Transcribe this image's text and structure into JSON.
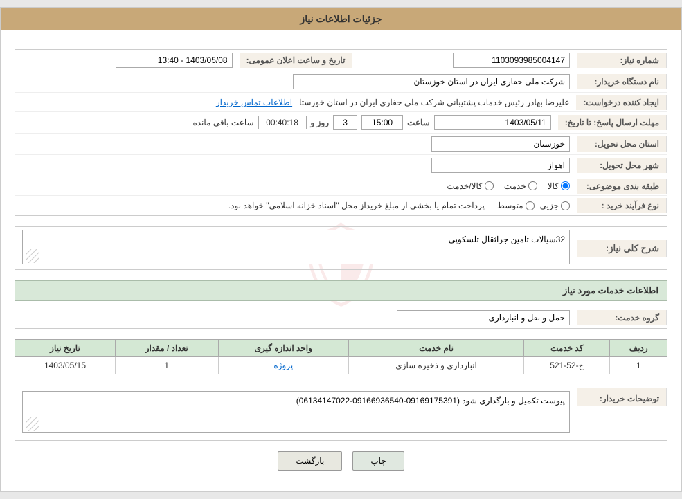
{
  "header": {
    "title": "جزئیات اطلاعات نیاز"
  },
  "fields": {
    "need_number_label": "شماره نیاز:",
    "need_number_value": "1103093985004147",
    "announce_date_label": "تاریخ و ساعت اعلان عمومی:",
    "announce_date_value": "1403/05/08 - 13:40",
    "buyer_org_label": "نام دستگاه خریدار:",
    "buyer_org_value": "شرکت ملی حفاری ایران در استان خوزستان",
    "creator_label": "ایجاد کننده درخواست:",
    "creator_value": "علیرضا بهادر رئیس خدمات پشتیبانی شرکت ملی حفاری ایران در استان خوزستا",
    "creator_link": "اطلاعات تماس خریدار",
    "deadline_label": "مهلت ارسال پاسخ: تا تاریخ:",
    "deadline_date": "1403/05/11",
    "deadline_time": "15:00",
    "deadline_days": "3",
    "deadline_countdown": "00:40:18",
    "deadline_remaining": "ساعت باقی مانده",
    "deadline_days_label": "روز و",
    "province_label": "استان محل تحویل:",
    "province_value": "خوزستان",
    "city_label": "شهر محل تحویل:",
    "city_value": "اهواز",
    "category_label": "طبقه بندی موضوعی:",
    "category_options": [
      "کالا",
      "خدمت",
      "کالا/خدمت"
    ],
    "category_selected": "کالا",
    "purchase_type_label": "نوع فرآیند خرید :",
    "purchase_options": [
      "جزیی",
      "متوسط"
    ],
    "purchase_note": "پرداخت تمام یا بخشی از مبلغ خریداز محل \"اسناد خزانه اسلامی\" خواهد بود.",
    "need_desc_label": "شرح کلی نیاز:",
    "need_desc_value": "32سیالات تامین جراثقال تلسکوپی",
    "services_info_label": "اطلاعات خدمات مورد نیاز",
    "service_group_label": "گروه خدمت:",
    "service_group_value": "حمل و نقل و انبارداری",
    "table": {
      "headers": [
        "ردیف",
        "کد خدمت",
        "نام خدمت",
        "واحد اندازه گیری",
        "تعداد / مقدار",
        "تاریخ نیاز"
      ],
      "rows": [
        {
          "row": "1",
          "code": "ح-52-521",
          "name": "انبارداری و ذخیره سازی",
          "unit": "پروژه",
          "quantity": "1",
          "date": "1403/05/15"
        }
      ]
    },
    "buyer_desc_label": "توضیحات خریدار:",
    "buyer_desc_value": "پیوست تکمیل و بارگذاری شود (09169175391-09166936540-06134147022)"
  },
  "buttons": {
    "print_label": "چاپ",
    "back_label": "بازگشت"
  }
}
